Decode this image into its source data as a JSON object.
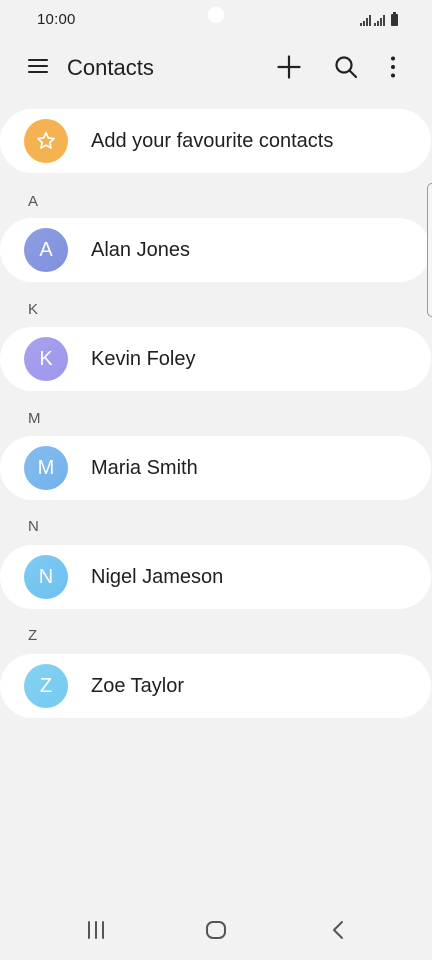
{
  "status_bar": {
    "time": "10:00"
  },
  "app_bar": {
    "title": "Contacts"
  },
  "favourites": {
    "label": "Add your favourite contacts"
  },
  "sections": [
    {
      "letter": "A",
      "contacts": [
        {
          "initial": "A",
          "name": "Alan Jones"
        }
      ]
    },
    {
      "letter": "K",
      "contacts": [
        {
          "initial": "K",
          "name": "Kevin Foley"
        }
      ]
    },
    {
      "letter": "M",
      "contacts": [
        {
          "initial": "M",
          "name": "Maria Smith"
        }
      ]
    },
    {
      "letter": "N",
      "contacts": [
        {
          "initial": "N",
          "name": "Nigel Jameson"
        }
      ]
    },
    {
      "letter": "Z",
      "contacts": [
        {
          "initial": "Z",
          "name": "Zoe Taylor"
        }
      ]
    }
  ],
  "icons": {
    "menu": "hamburger-menu-icon",
    "add": "plus-icon",
    "search": "search-icon",
    "more": "more-vertical-icon",
    "favourite": "star-icon",
    "nav_recent": "recent-apps-icon",
    "nav_home": "home-icon",
    "nav_back": "back-icon"
  },
  "colors": {
    "background": "#f2f2f2",
    "card": "#ffffff",
    "favourite_avatar": "#f4b350",
    "avatar_a": "#8a99e1",
    "avatar_k": "#a49dee",
    "avatar_m": "#7bb7ee",
    "avatar_n": "#76c6f1",
    "avatar_z": "#7dcef1"
  }
}
